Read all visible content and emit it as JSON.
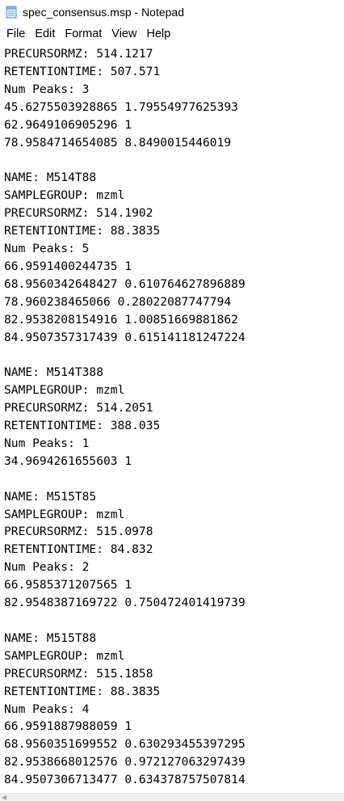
{
  "window": {
    "title": "spec_consensus.msp - Notepad",
    "app_icon": "notepad-icon"
  },
  "menu": {
    "items": [
      {
        "label": "File"
      },
      {
        "label": "Edit"
      },
      {
        "label": "Format"
      },
      {
        "label": "View"
      },
      {
        "label": "Help"
      }
    ]
  },
  "editor": {
    "lines": [
      "PRECURSORMZ: 514.1217",
      "RETENTIONTIME: 507.571",
      "Num Peaks: 3",
      "45.6275503928865 1.79554977625393",
      "62.9649106905296 1",
      "78.9584714654085 8.8490015446019",
      "",
      "NAME: M514T88",
      "SAMPLEGROUP: mzml",
      "PRECURSORMZ: 514.1902",
      "RETENTIONTIME: 88.3835",
      "Num Peaks: 5",
      "66.9591400244735 1",
      "68.9560342648427 0.610764627896889",
      "78.960238465066 0.28022087747794",
      "82.9538208154916 1.00851669881862",
      "84.9507357317439 0.615141181247224",
      "",
      "NAME: M514T388",
      "SAMPLEGROUP: mzml",
      "PRECURSORMZ: 514.2051",
      "RETENTIONTIME: 388.035",
      "Num Peaks: 1",
      "34.9694261655603 1",
      "",
      "NAME: M515T85",
      "SAMPLEGROUP: mzml",
      "PRECURSORMZ: 515.0978",
      "RETENTIONTIME: 84.832",
      "Num Peaks: 2",
      "66.9585371207565 1",
      "82.9548387169722 0.750472401419739",
      "",
      "NAME: M515T88",
      "SAMPLEGROUP: mzml",
      "PRECURSORMZ: 515.1858",
      "RETENTIONTIME: 88.3835",
      "Num Peaks: 4",
      "66.9591887988059 1",
      "68.9560351699552 0.630293455397295",
      "82.9538668012576 0.972127063297439",
      "84.9507306713477 0.634378757507814"
    ]
  },
  "scrollbar": {
    "left_arrow_icon": "chevron-left-icon"
  }
}
